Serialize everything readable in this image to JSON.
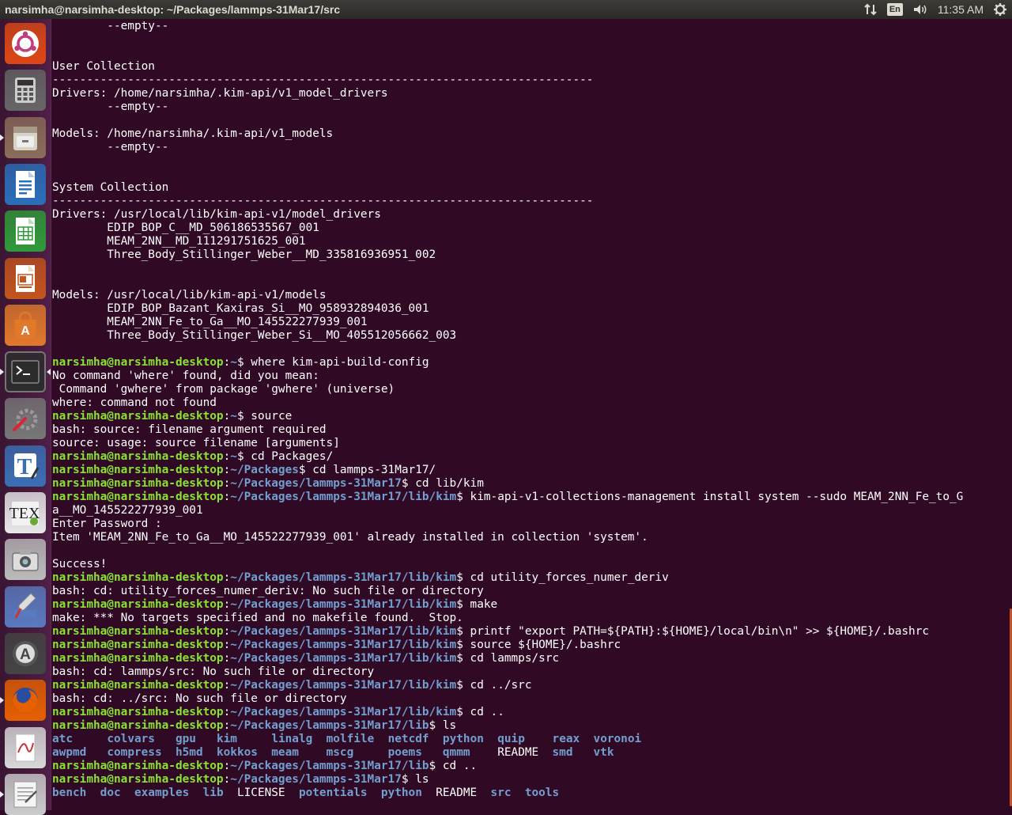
{
  "window": {
    "title": "narsimha@narsimha-desktop: ~/Packages/lammps-31Mar17/src"
  },
  "tray": {
    "network_icon": "network-updown-icon",
    "keyboard_layout": "En",
    "volume_icon": "speaker-icon",
    "clock": "11:35 AM",
    "settings_icon": "gear-icon"
  },
  "launcher": [
    {
      "name": "ubuntu-dash-icon",
      "icon": "ubuntu-logo",
      "color": "#dd4814"
    },
    {
      "name": "calculator-icon",
      "icon": "calculator",
      "color": "#666666"
    },
    {
      "name": "files-icon",
      "icon": "file-cabinet",
      "color": "#8a6d5a",
      "running": true
    },
    {
      "name": "libreoffice-writer-icon",
      "icon": "writer",
      "color": "#2a6fbb"
    },
    {
      "name": "libreoffice-calc-icon",
      "icon": "calc",
      "color": "#2f9b3a"
    },
    {
      "name": "libreoffice-impress-icon",
      "icon": "impress",
      "color": "#c3541e"
    },
    {
      "name": "ubuntu-software-icon",
      "icon": "shopping-bag",
      "color": "#e0792b"
    },
    {
      "name": "terminal-icon",
      "icon": "terminal",
      "color": "#2c2c2c",
      "running": true,
      "active": true
    },
    {
      "name": "system-settings-icon",
      "icon": "wrench-gear",
      "color": "#777777"
    },
    {
      "name": "texmaker-icon",
      "icon": "text-editor-t",
      "color": "#3b6fb5"
    },
    {
      "name": "tex-icon",
      "icon": "tex",
      "color": "#e8e8e8"
    },
    {
      "name": "screenshot-icon",
      "icon": "camera",
      "color": "#bbbbbb"
    },
    {
      "name": "paint-icon",
      "icon": "paintbrush",
      "color": "#5a7abf"
    },
    {
      "name": "software-updater-icon",
      "icon": "updater-a",
      "color": "#444444"
    },
    {
      "name": "firefox-icon",
      "icon": "firefox",
      "color": "#e66000",
      "running": true
    },
    {
      "name": "pdf-viewer-icon",
      "icon": "pdf",
      "color": "#d8d8d8"
    },
    {
      "name": "text-editor-icon",
      "icon": "notepad",
      "color": "#cccccc",
      "running": true
    }
  ],
  "terminal": {
    "user": "narsimha@narsimha-desktop",
    "lines": [
      {
        "t": "out",
        "text": "        --empty--"
      },
      {
        "t": "out",
        "text": ""
      },
      {
        "t": "out",
        "text": ""
      },
      {
        "t": "out",
        "text": "User Collection"
      },
      {
        "t": "out",
        "text": "-------------------------------------------------------------------------------"
      },
      {
        "t": "out",
        "text": "Drivers: /home/narsimha/.kim-api/v1_model_drivers"
      },
      {
        "t": "out",
        "text": "        --empty--"
      },
      {
        "t": "out",
        "text": ""
      },
      {
        "t": "out",
        "text": "Models: /home/narsimha/.kim-api/v1_models"
      },
      {
        "t": "out",
        "text": "        --empty--"
      },
      {
        "t": "out",
        "text": ""
      },
      {
        "t": "out",
        "text": ""
      },
      {
        "t": "out",
        "text": "System Collection"
      },
      {
        "t": "out",
        "text": "-------------------------------------------------------------------------------"
      },
      {
        "t": "out",
        "text": "Drivers: /usr/local/lib/kim-api-v1/model_drivers"
      },
      {
        "t": "out",
        "text": "        EDIP_BOP_C__MD_506186535567_001"
      },
      {
        "t": "out",
        "text": "        MEAM_2NN__MD_111291751625_001"
      },
      {
        "t": "out",
        "text": "        Three_Body_Stillinger_Weber__MD_335816936951_002"
      },
      {
        "t": "out",
        "text": ""
      },
      {
        "t": "out",
        "text": ""
      },
      {
        "t": "out",
        "text": "Models: /usr/local/lib/kim-api-v1/models"
      },
      {
        "t": "out",
        "text": "        EDIP_BOP_Bazant_Kaxiras_Si__MO_958932894036_001"
      },
      {
        "t": "out",
        "text": "        MEAM_2NN_Fe_to_Ga__MO_145522277939_001"
      },
      {
        "t": "out",
        "text": "        Three_Body_Stillinger_Weber_Si__MO_405512056662_003"
      },
      {
        "t": "out",
        "text": ""
      },
      {
        "t": "prompt",
        "path": "~",
        "cmd": " where kim-api-build-config"
      },
      {
        "t": "out",
        "text": "No command 'where' found, did you mean:"
      },
      {
        "t": "out",
        "text": " Command 'gwhere' from package 'gwhere' (universe)"
      },
      {
        "t": "out",
        "text": "where: command not found"
      },
      {
        "t": "prompt",
        "path": "~",
        "cmd": " source"
      },
      {
        "t": "out",
        "text": "bash: source: filename argument required"
      },
      {
        "t": "out",
        "text": "source: usage: source filename [arguments]"
      },
      {
        "t": "prompt",
        "path": "~",
        "cmd": " cd Packages/"
      },
      {
        "t": "prompt",
        "path": "~/Packages",
        "cmd": " cd lammps-31Mar17/"
      },
      {
        "t": "prompt",
        "path": "~/Packages/lammps-31Mar17",
        "cmd": " cd lib/kim"
      },
      {
        "t": "prompt",
        "path": "~/Packages/lammps-31Mar17/lib/kim",
        "cmd": " kim-api-v1-collections-management install system --sudo MEAM_2NN_Fe_to_G"
      },
      {
        "t": "out",
        "text": "a__MO_145522277939_001"
      },
      {
        "t": "out",
        "text": "Enter Password :"
      },
      {
        "t": "out",
        "text": "Item 'MEAM_2NN_Fe_to_Ga__MO_145522277939_001' already installed in collection 'system'."
      },
      {
        "t": "out",
        "text": ""
      },
      {
        "t": "out",
        "text": "Success!"
      },
      {
        "t": "prompt",
        "path": "~/Packages/lammps-31Mar17/lib/kim",
        "cmd": " cd utility_forces_numer_deriv"
      },
      {
        "t": "out",
        "text": "bash: cd: utility_forces_numer_deriv: No such file or directory"
      },
      {
        "t": "prompt",
        "path": "~/Packages/lammps-31Mar17/lib/kim",
        "cmd": " make"
      },
      {
        "t": "out",
        "text": "make: *** No targets specified and no makefile found.  Stop."
      },
      {
        "t": "prompt",
        "path": "~/Packages/lammps-31Mar17/lib/kim",
        "cmd": " printf \"export PATH=${PATH}:${HOME}/local/bin\\n\" >> ${HOME}/.bashrc"
      },
      {
        "t": "prompt",
        "path": "~/Packages/lammps-31Mar17/lib/kim",
        "cmd": " source ${HOME}/.bashrc"
      },
      {
        "t": "prompt",
        "path": "~/Packages/lammps-31Mar17/lib/kim",
        "cmd": " cd lammps/src"
      },
      {
        "t": "out",
        "text": "bash: cd: lammps/src: No such file or directory"
      },
      {
        "t": "prompt",
        "path": "~/Packages/lammps-31Mar17/lib/kim",
        "cmd": " cd ../src"
      },
      {
        "t": "out",
        "text": "bash: cd: ../src: No such file or directory"
      },
      {
        "t": "prompt",
        "path": "~/Packages/lammps-31Mar17/lib/kim",
        "cmd": " cd .."
      },
      {
        "t": "prompt",
        "path": "~/Packages/lammps-31Mar17/lib",
        "cmd": " ls"
      },
      {
        "t": "ls",
        "items": [
          {
            "text": "atc",
            "dir": true
          },
          {
            "text": "     "
          },
          {
            "text": "colvars",
            "dir": true
          },
          {
            "text": "   "
          },
          {
            "text": "gpu",
            "dir": true
          },
          {
            "text": "   "
          },
          {
            "text": "kim",
            "dir": true
          },
          {
            "text": "     "
          },
          {
            "text": "linalg",
            "dir": true
          },
          {
            "text": "  "
          },
          {
            "text": "molfile",
            "dir": true
          },
          {
            "text": "  "
          },
          {
            "text": "netcdf",
            "dir": true
          },
          {
            "text": "  "
          },
          {
            "text": "python",
            "dir": true
          },
          {
            "text": "  "
          },
          {
            "text": "quip",
            "dir": true
          },
          {
            "text": "    "
          },
          {
            "text": "reax",
            "dir": true
          },
          {
            "text": "  "
          },
          {
            "text": "voronoi",
            "dir": true
          }
        ]
      },
      {
        "t": "ls",
        "items": [
          {
            "text": "awpmd",
            "dir": true
          },
          {
            "text": "   "
          },
          {
            "text": "compress",
            "dir": true
          },
          {
            "text": "  "
          },
          {
            "text": "h5md",
            "dir": true
          },
          {
            "text": "  "
          },
          {
            "text": "kokkos",
            "dir": true
          },
          {
            "text": "  "
          },
          {
            "text": "meam",
            "dir": true
          },
          {
            "text": "    "
          },
          {
            "text": "mscg",
            "dir": true
          },
          {
            "text": "     "
          },
          {
            "text": "poems",
            "dir": true
          },
          {
            "text": "   "
          },
          {
            "text": "qmmm",
            "dir": true
          },
          {
            "text": "    "
          },
          {
            "text": "README"
          },
          {
            "text": "  "
          },
          {
            "text": "smd",
            "dir": true
          },
          {
            "text": "   "
          },
          {
            "text": "vtk",
            "dir": true
          }
        ]
      },
      {
        "t": "prompt",
        "path": "~/Packages/lammps-31Mar17/lib",
        "cmd": " cd .."
      },
      {
        "t": "prompt",
        "path": "~/Packages/lammps-31Mar17",
        "cmd": " ls"
      },
      {
        "t": "ls",
        "items": [
          {
            "text": "bench",
            "dir": true
          },
          {
            "text": "  "
          },
          {
            "text": "doc",
            "dir": true
          },
          {
            "text": "  "
          },
          {
            "text": "examples",
            "dir": true
          },
          {
            "text": "  "
          },
          {
            "text": "lib",
            "dir": true
          },
          {
            "text": "  "
          },
          {
            "text": "LICENSE"
          },
          {
            "text": "  "
          },
          {
            "text": "potentials",
            "dir": true
          },
          {
            "text": "  "
          },
          {
            "text": "python",
            "dir": true
          },
          {
            "text": "  "
          },
          {
            "text": "README"
          },
          {
            "text": "  "
          },
          {
            "text": "src",
            "dir": true
          },
          {
            "text": "  "
          },
          {
            "text": "tools",
            "dir": true
          }
        ]
      }
    ]
  }
}
